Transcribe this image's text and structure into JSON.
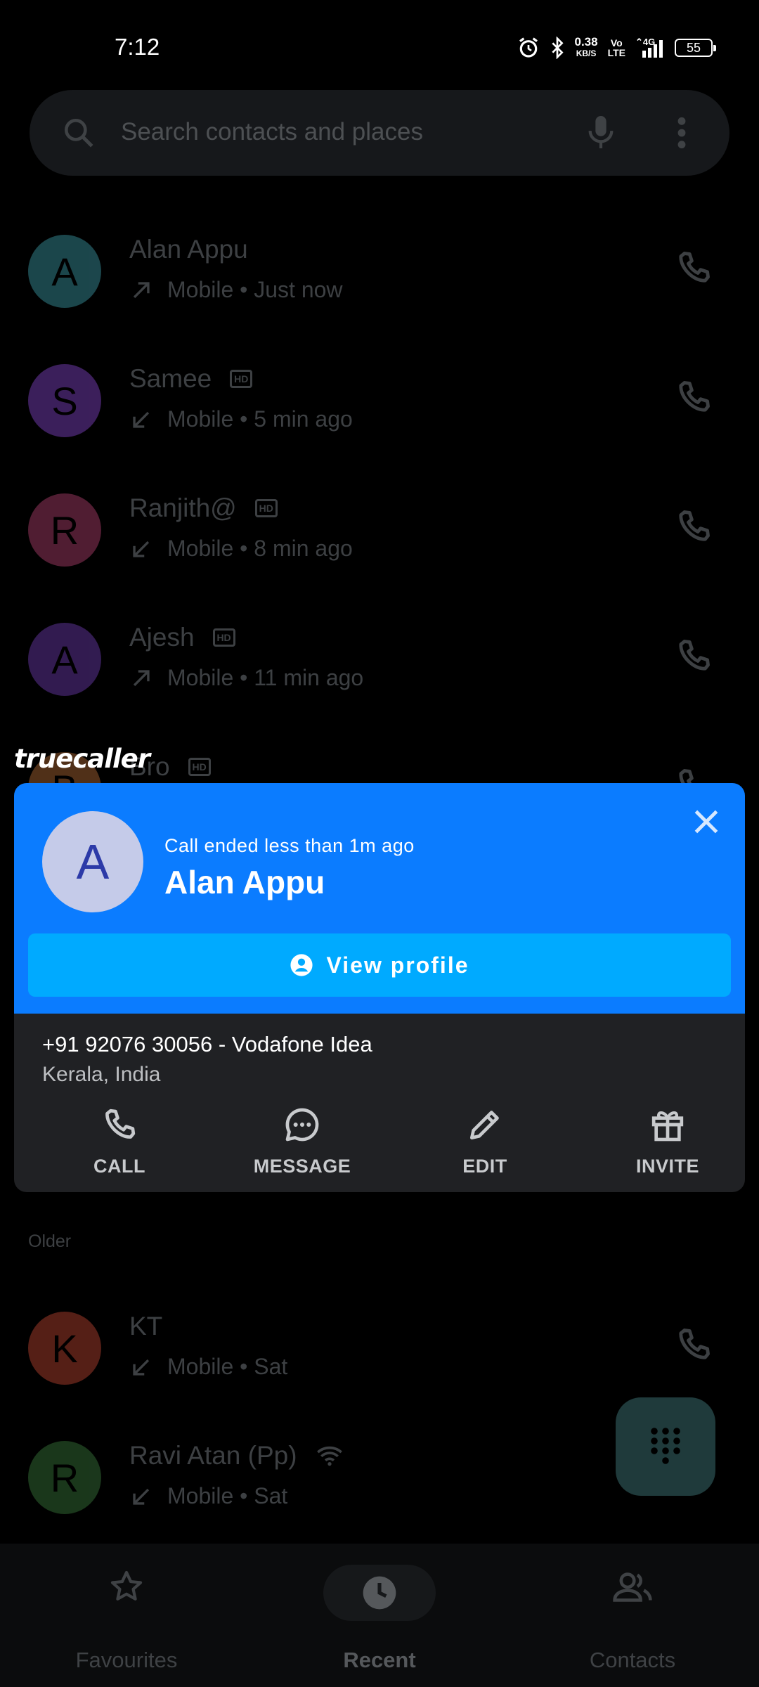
{
  "status_bar": {
    "time": "7:12",
    "net_speed_value": "0.38",
    "net_speed_unit": "KB/S",
    "volte_top": "Vo",
    "volte_bottom": "LTE",
    "network": "4G",
    "battery": "55"
  },
  "search": {
    "placeholder": "Search contacts and places"
  },
  "recent_calls": [
    {
      "initial": "A",
      "name": "Alan Appu",
      "hd": false,
      "direction": "outgoing",
      "detail": "Mobile • Just now",
      "avatar_color": "#1d4a50"
    },
    {
      "initial": "S",
      "name": "Samee",
      "hd": true,
      "direction": "incoming",
      "detail": "Mobile • 5 min ago",
      "avatar_color": "#3f2160"
    },
    {
      "initial": "R",
      "name": "Ranjith@",
      "hd": true,
      "direction": "incoming",
      "detail": "Mobile • 8 min ago",
      "avatar_color": "#551f35"
    },
    {
      "initial": "A",
      "name": "Ajesh",
      "hd": true,
      "direction": "outgoing",
      "detail": "Mobile • 11 min ago",
      "avatar_color": "#351d55"
    },
    {
      "initial": "B",
      "name": "Bro",
      "hd": true,
      "direction": "incoming",
      "detail": "",
      "avatar_color": "#55331a"
    }
  ],
  "section_older": "Older",
  "older_calls": [
    {
      "initial": "K",
      "name": "KT",
      "hd": false,
      "direction": "incoming",
      "detail": "Mobile • Sat",
      "avatar_color": "#5a2118"
    },
    {
      "initial": "R",
      "name": "Ravi Atan (Pp)",
      "hd": false,
      "wifi": true,
      "direction": "incoming",
      "detail": "Mobile • Sat",
      "avatar_color": "#1c3a1d"
    }
  ],
  "bottom_nav": {
    "favourites": "Favourites",
    "recent": "Recent",
    "contacts": "Contacts"
  },
  "truecaller": {
    "logo": "truecaller",
    "subtitle": "Call ended less than 1m ago",
    "initial": "A",
    "name": "Alan Appu",
    "view_profile": "View profile",
    "number": "+91 92076 30056 - Vodafone Idea",
    "location": "Kerala, India",
    "actions": {
      "call": "CALL",
      "message": "MESSAGE",
      "edit": "EDIT",
      "invite": "INVITE"
    }
  },
  "colors": {
    "header_blue": "#0b7cff",
    "button_blue": "#00aaff",
    "card_bg": "#202124"
  }
}
